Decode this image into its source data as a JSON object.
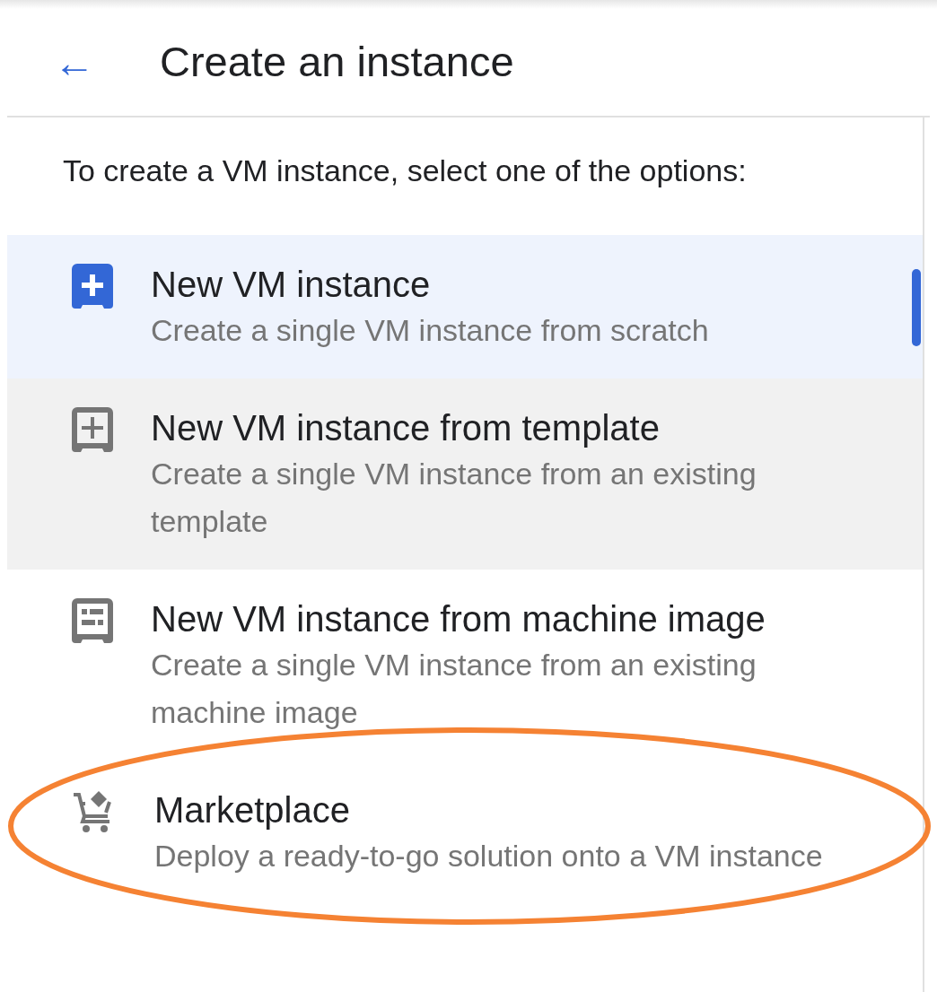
{
  "header": {
    "back": "←",
    "title": "Create an instance"
  },
  "intro": "To create a VM instance, select one of the options:",
  "options": [
    {
      "kind": "new",
      "title": "New VM instance",
      "description": "Create a single VM instance from scratch",
      "selected": true,
      "hovered": false,
      "highlighted": false
    },
    {
      "kind": "template",
      "title": "New VM instance from template",
      "description": "Create a single VM instance from an existing template",
      "selected": false,
      "hovered": true,
      "highlighted": false
    },
    {
      "kind": "image",
      "title": "New VM instance from machine image",
      "description": "Create a single VM instance from an existing machine image",
      "selected": false,
      "hovered": false,
      "highlighted": false
    },
    {
      "kind": "marketplace",
      "title": "Marketplace",
      "description": "Deploy a ready-to-go solution onto a VM instance",
      "selected": false,
      "hovered": false,
      "highlighted": true
    }
  ]
}
